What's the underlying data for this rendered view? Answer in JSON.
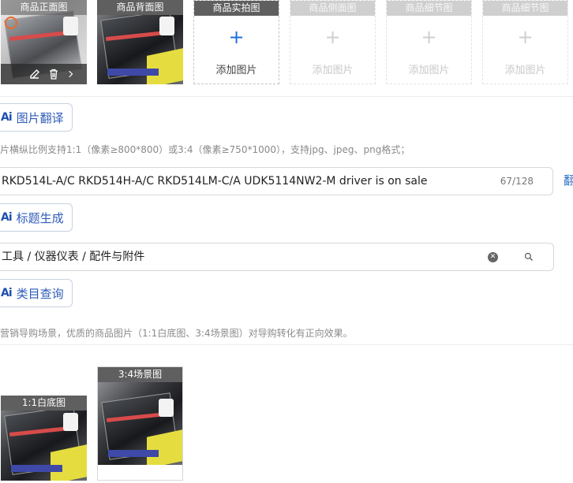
{
  "image_slots": [
    {
      "label": "商品正面图",
      "state": "filled"
    },
    {
      "label": "商品背面图",
      "state": "filled"
    },
    {
      "label": "商品实拍图",
      "state": "add",
      "add_text": "添加图片"
    },
    {
      "label": "商品侧面图",
      "state": "disabled",
      "add_text": "添加图片"
    },
    {
      "label": "商品细节图",
      "state": "disabled",
      "add_text": "添加图片"
    },
    {
      "label": "商品细节图",
      "state": "disabled",
      "add_text": "添加图片"
    }
  ],
  "ai_buttons": {
    "mark": "Ai",
    "image_translate": "图片翻译",
    "title_generate": "标题生成",
    "category_query": "类目查询"
  },
  "image_hint": "片横纵比例支持1:1（像素≥800*800）或3:4（像素≥750*1000），支持jpg、jpeg、png格式；",
  "title_field": {
    "value": "RKD514L-A/C RKD514H-A/C RKD514LM-C/A UDK5114NW2-M driver is on sale",
    "counter": "67/128",
    "side_text": "翻"
  },
  "category_field": {
    "value": "工具 / 仪器仪表 / 配件与附件"
  },
  "scene_hint": "营销导购场景，优质的商品图片（1:1白底图、3:4场景图）对导购转化有正向效果。",
  "scene_images": [
    {
      "label": "1:1白底图"
    },
    {
      "label": "3:4场景图"
    }
  ],
  "colors": {
    "accent": "#1e6fd9",
    "label_bg": "#5f5f5f",
    "border": "#d7d7d7"
  }
}
